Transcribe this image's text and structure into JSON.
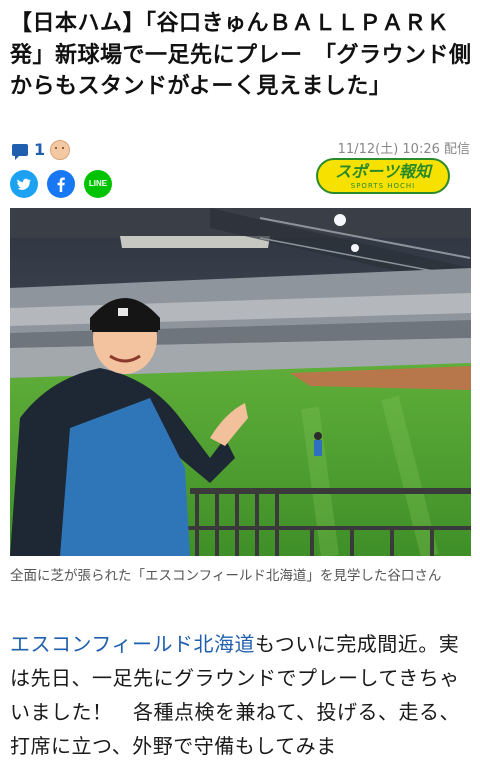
{
  "article": {
    "headline": "【日本ハム】「谷口きゅんＢＡＬＬＰＡＲＫ発」新球場で一足先にプレー　「グラウンド側からもスタンドがよーく見えました」",
    "comment_count": "1",
    "timestamp": "11/12(土) 10:26 配信",
    "source_logo": {
      "main": "スポーツ報知",
      "sub": "SPORTS HOCHI"
    },
    "share": {
      "twitter_icon": "twitter-icon",
      "facebook_icon": "facebook-icon",
      "line_label": "LINE"
    },
    "photo_caption": "全面に芝が張られた「エスコンフィールド北海道」を見学した谷口さん",
    "body_link": "エスコンフィールド北海道",
    "body_rest": "もついに完成間近。実は先日、一足先にグラウンドでプレーしてきちゃいました！　各種点検を兼ねて、投げる、走る、打席に立つ、外野で守備もしてみま"
  },
  "colors": {
    "link": "#1f5fae",
    "twitter": "#1da1f2",
    "facebook": "#1877f2",
    "line": "#00c300",
    "logo_yellow": "#f7e100",
    "logo_green": "#2a8a2a"
  }
}
